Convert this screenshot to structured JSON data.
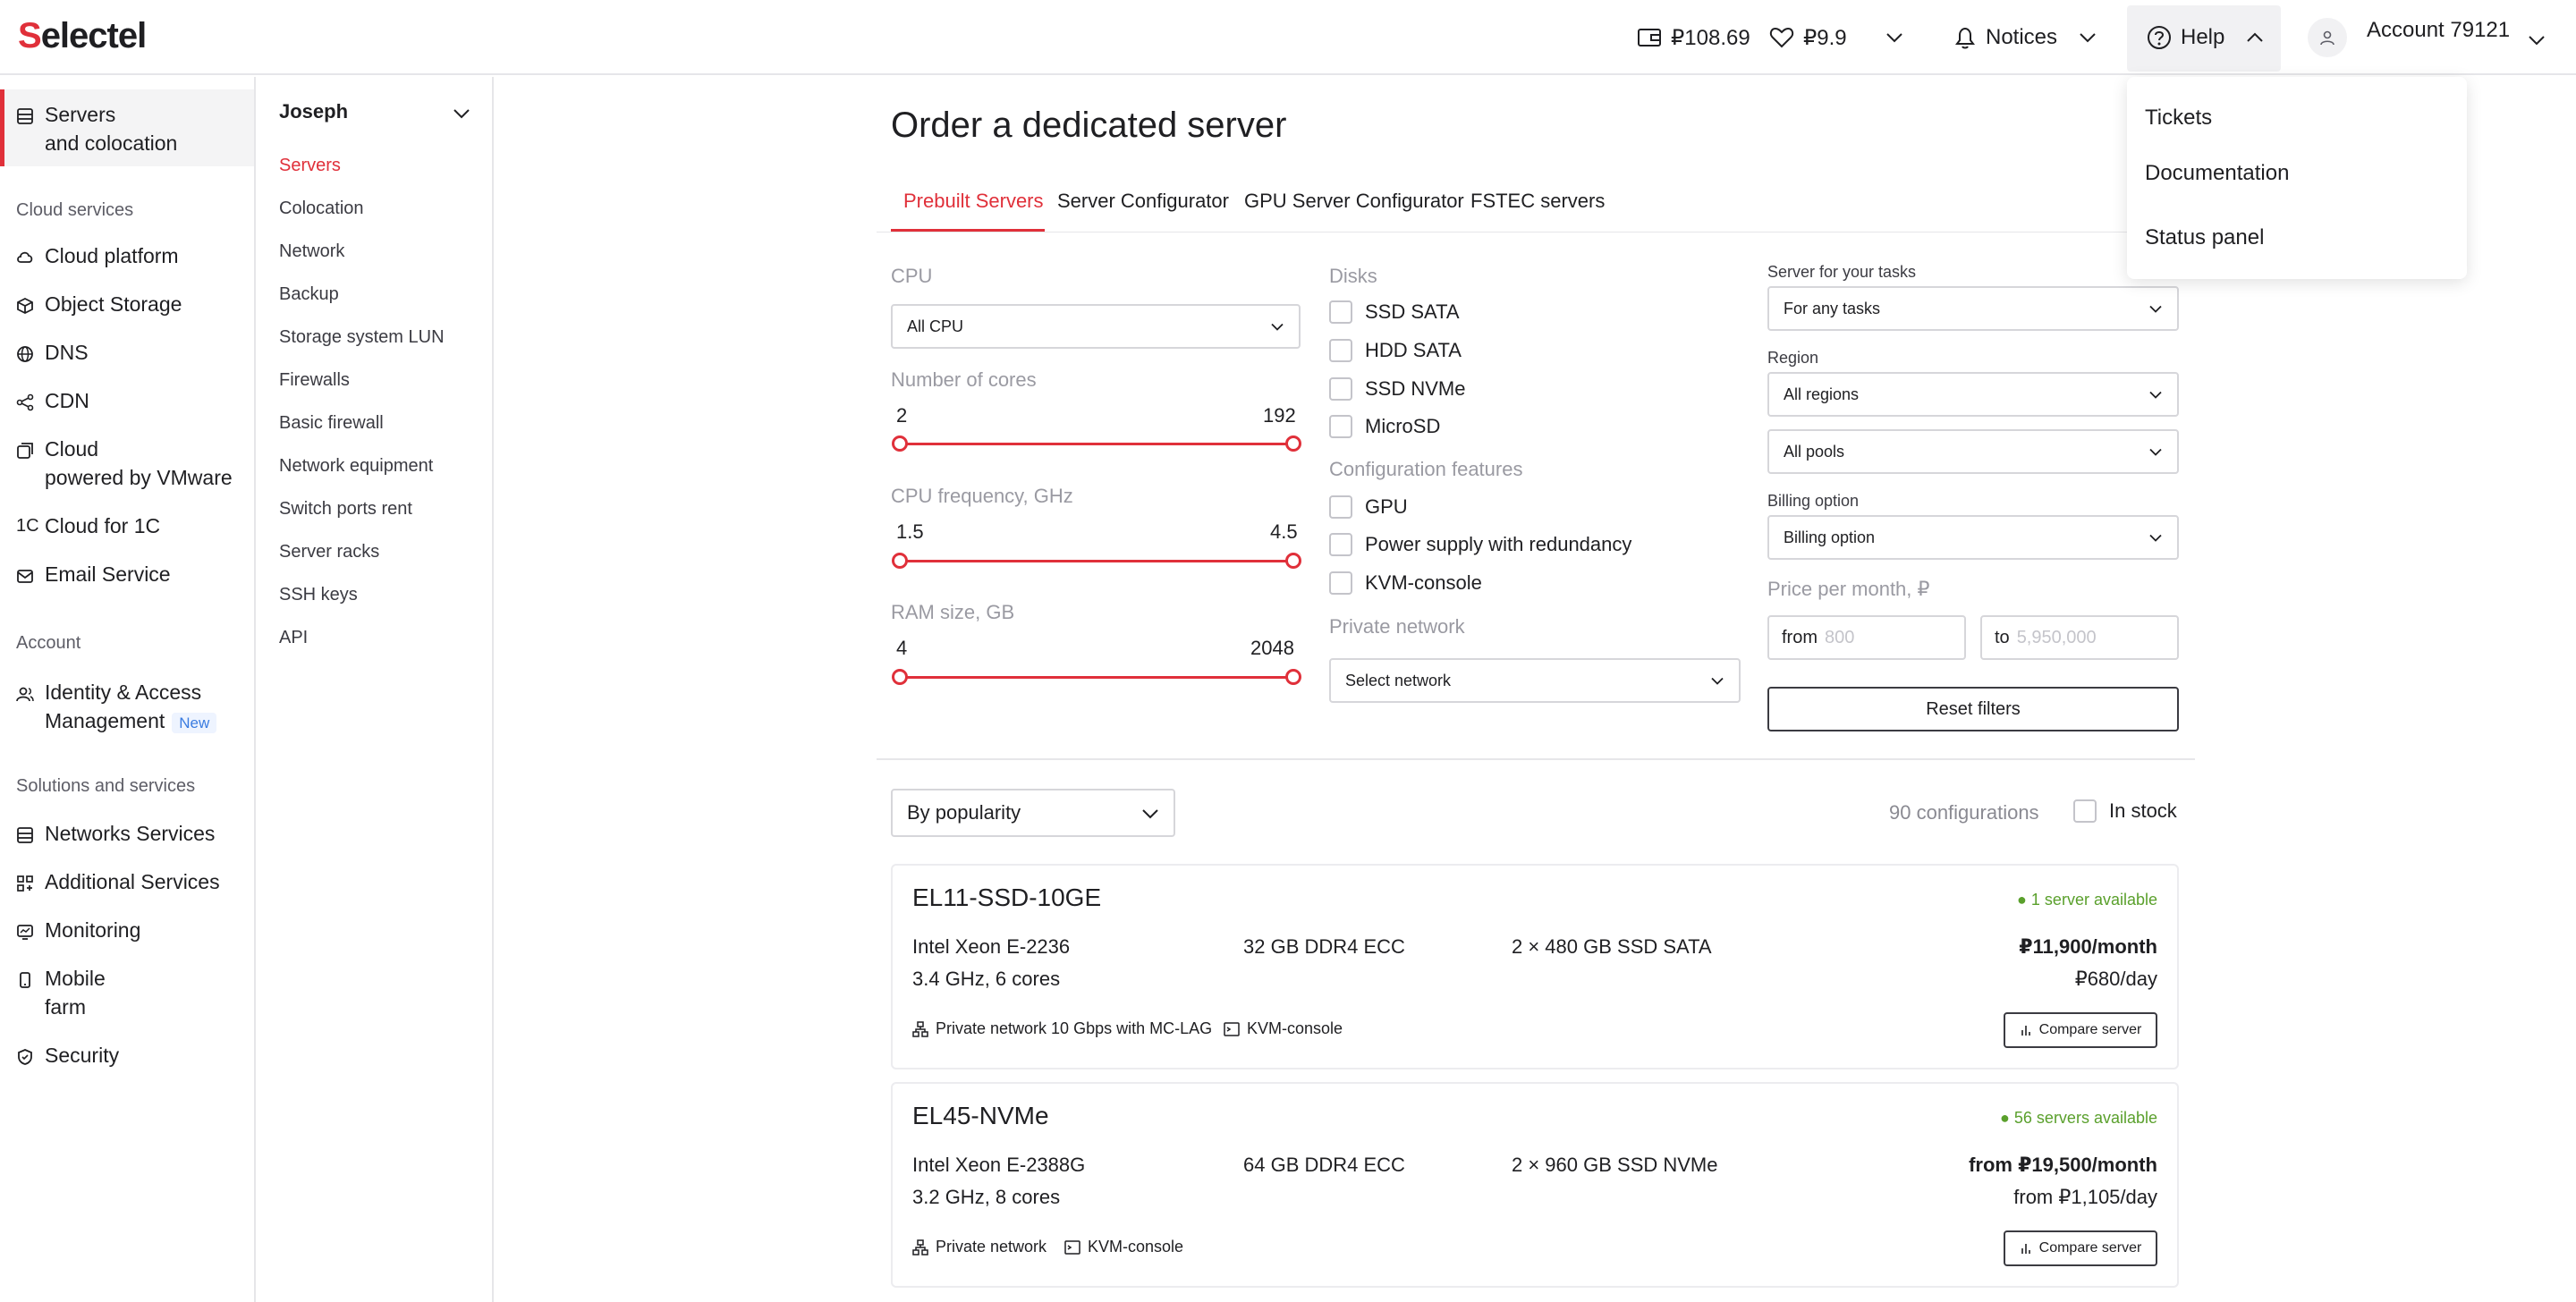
{
  "header": {
    "logo_text": "Selectel",
    "balance": "₽108.69",
    "bonus": "₽9.9",
    "notices_label": "Notices",
    "help_label": "Help",
    "account_label": "Account 79121"
  },
  "help_menu": {
    "items": [
      "Tickets",
      "Documentation",
      "Status panel"
    ]
  },
  "sidebar": {
    "active_item": {
      "line1": "Servers",
      "line2": "and colocation",
      "icon": "server-icon"
    },
    "sections": [
      {
        "title": "Cloud services"
      },
      {
        "title": "Account"
      },
      {
        "title": "Solutions and services"
      }
    ],
    "cloud_items": [
      {
        "label": "Cloud platform",
        "icon": "cloud-icon"
      },
      {
        "label": "Object Storage",
        "icon": "box-icon"
      },
      {
        "label": "DNS",
        "icon": "globe-icon"
      },
      {
        "label": "CDN",
        "icon": "share-icon"
      },
      {
        "line1": "Cloud",
        "line2": "powered by VMware",
        "icon": "vmware-icon"
      },
      {
        "label": "Cloud for 1C",
        "icon": "1c-icon"
      },
      {
        "label": "Email Service",
        "icon": "mail-icon"
      }
    ],
    "account_items": [
      {
        "line1": "Identity & Access",
        "line2": "Management",
        "badge": "New",
        "icon": "users-icon"
      }
    ],
    "solution_items": [
      {
        "label": "Networks Services",
        "icon": "network-icon"
      },
      {
        "label": "Additional Services",
        "icon": "grid-plus-icon"
      },
      {
        "label": "Monitoring",
        "icon": "monitor-icon"
      },
      {
        "line1": "Mobile",
        "line2": "farm",
        "icon": "phone-icon"
      },
      {
        "label": "Security",
        "icon": "shield-icon"
      }
    ]
  },
  "subnav": {
    "project": "Joseph",
    "items": [
      "Servers",
      "Colocation",
      "Network",
      "Backup",
      "Storage system LUN",
      "Firewalls",
      "Basic firewall",
      "Network equipment",
      "Switch ports rent",
      "Server racks",
      "SSH keys",
      "API"
    ]
  },
  "main": {
    "title": "Order a dedicated server",
    "tabs": [
      "Prebuilt Servers",
      "Server Configurator",
      "GPU Server Configurator",
      "FSTEC servers"
    ],
    "filters": {
      "cpu_label": "CPU",
      "cpu_value": "All CPU",
      "cores_label": "Number of cores",
      "cores_min": "2",
      "cores_max": "192",
      "freq_label": "CPU frequency, GHz",
      "freq_min": "1.5",
      "freq_max": "4.5",
      "ram_label": "RAM size, GB",
      "ram_min": "4",
      "ram_max": "2048",
      "disks_label": "Disks",
      "disks": [
        "SSD SATA",
        "HDD SATA",
        "SSD NVMe",
        "MicroSD"
      ],
      "config_label": "Configuration features",
      "config": [
        "GPU",
        "Power supply with redundancy",
        "KVM-console"
      ],
      "private_network_label": "Private network",
      "private_network_value": "Select network",
      "tasks_label": "Server for your tasks",
      "tasks_value": "For any tasks",
      "region_label": "Region",
      "region_value": "All regions",
      "pools_value": "All pools",
      "billing_label": "Billing option",
      "billing_value": "Billing option",
      "price_label": "Price per month, ₽",
      "price_from_label": "from",
      "price_from_placeholder": "800",
      "price_to_label": "to",
      "price_to_placeholder": "5,950,000",
      "reset_label": "Reset filters"
    },
    "sort_value": "By popularity",
    "config_count": "90 configurations",
    "in_stock_label": "In stock",
    "servers": [
      {
        "name": "EL11-SSD-10GE",
        "availability": "1 server available",
        "cpu": "Intel Xeon E-2236",
        "cpu_detail": "3.4 GHz, 6 cores",
        "ram": "32 GB DDR4 ECC",
        "disk": "2 × 480 GB SSD SATA",
        "price_month": "₽11,900/month",
        "price_day": "₽680/day",
        "features": [
          "Private network 10 Gbps with MC-LAG",
          "KVM-console"
        ],
        "compare_label": "Compare server"
      },
      {
        "name": "EL45-NVMe",
        "availability": "56 servers available",
        "cpu": "Intel Xeon E-2388G",
        "cpu_detail": "3.2 GHz, 8 cores",
        "ram": "64 GB DDR4 ECC",
        "disk": "2 × 960 GB SSD NVMe",
        "price_month": "from ₽19,500/month",
        "price_day": "from ₽1,105/day",
        "features": [
          "Private network",
          "KVM-console"
        ],
        "compare_label": "Compare server"
      }
    ]
  },
  "colors": {
    "accent": "#e0303a",
    "available": "#5aa02c",
    "border": "#e6e6e9"
  }
}
